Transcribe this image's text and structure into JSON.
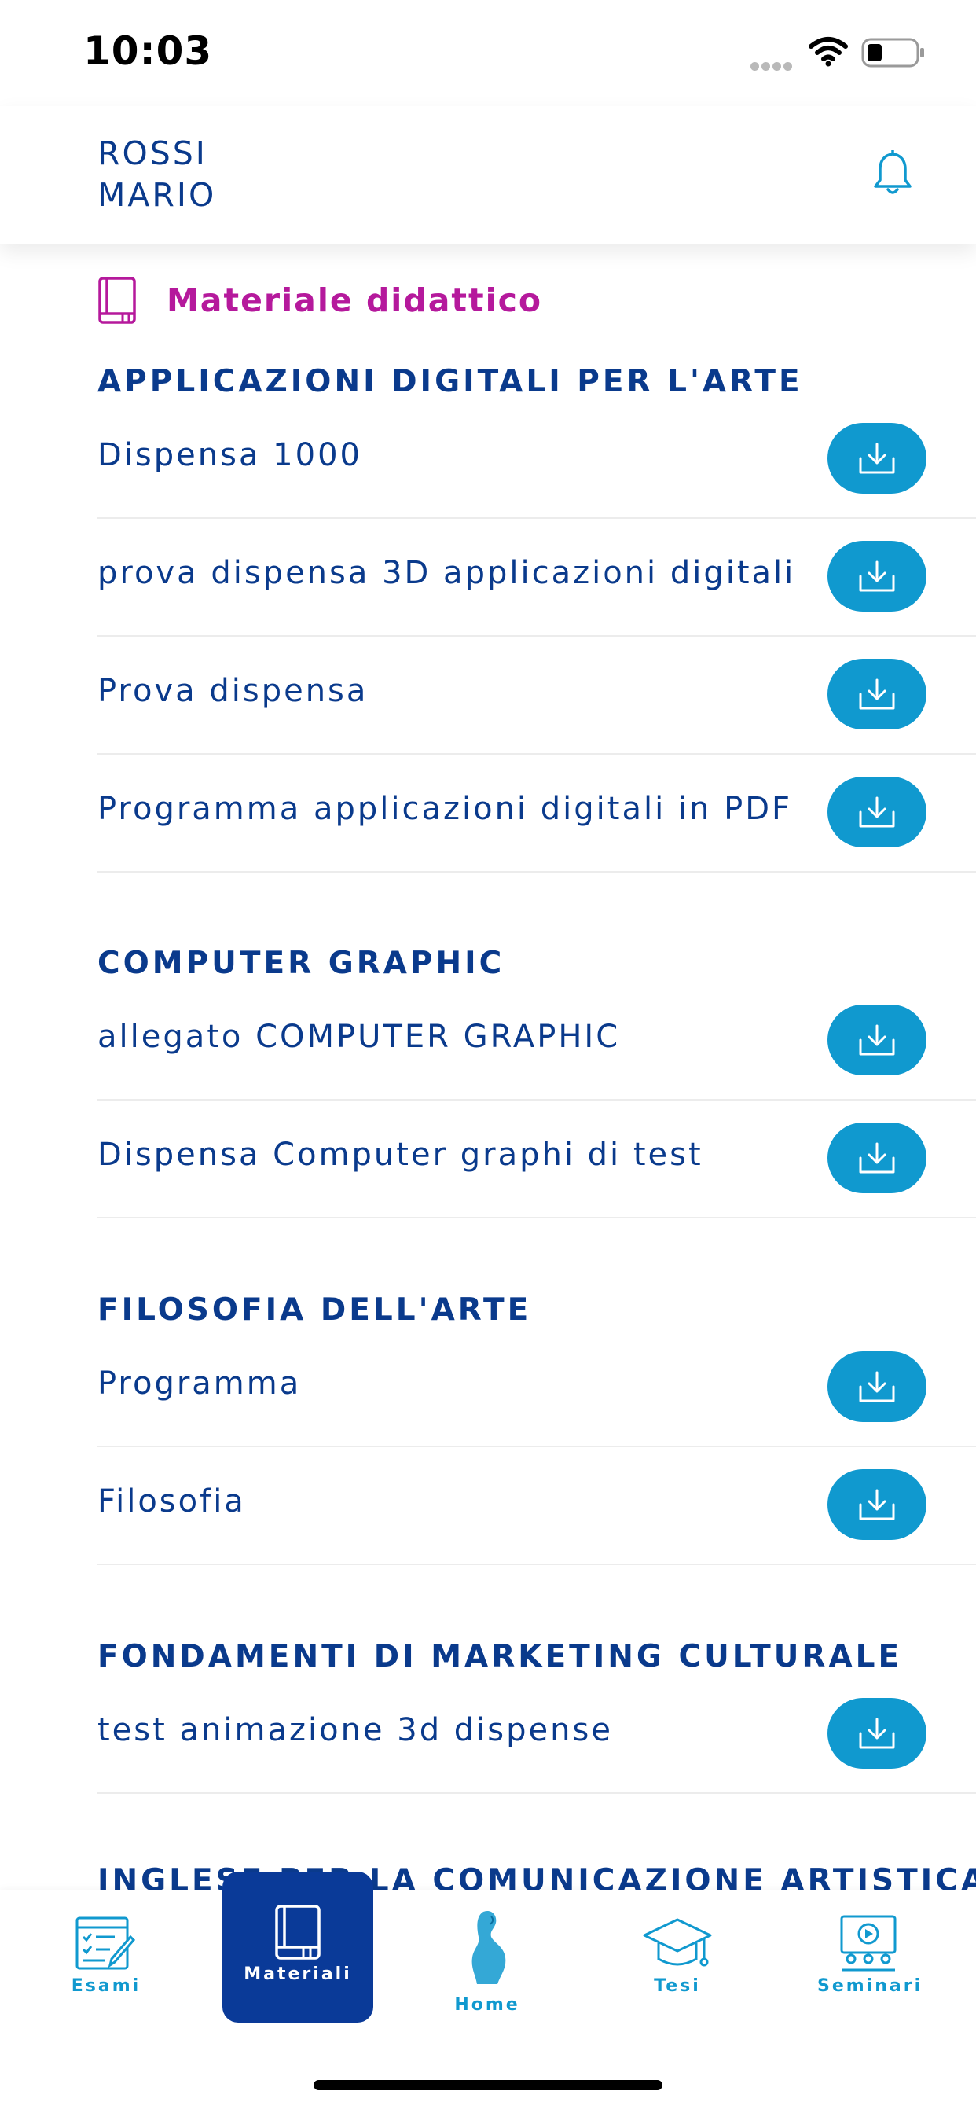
{
  "status_bar": {
    "time": "10:03"
  },
  "header": {
    "user_line1": "ROSSI",
    "user_line2": "MARIO",
    "bell_icon": "bell-icon"
  },
  "section": {
    "title": "Materiale didattico",
    "icon": "book-icon",
    "title_color": "#b5199c"
  },
  "groups": [
    {
      "title": "APPLICAZIONI DIGITALI PER L'ARTE",
      "items": [
        "Dispensa 1000",
        "prova dispensa 3D applicazioni digitali",
        "Prova dispensa",
        "Programma applicazioni digitali in PDF"
      ]
    },
    {
      "title": "COMPUTER GRAPHIC",
      "items": [
        "allegato COMPUTER GRAPHIC",
        "Dispensa Computer graphi di test"
      ]
    },
    {
      "title": "FILOSOFIA DELL'ARTE",
      "items": [
        "Programma",
        "Filosofia"
      ]
    },
    {
      "title": "FONDAMENTI DI MARKETING CULTURALE",
      "items": [
        "test animazione 3d dispense"
      ]
    },
    {
      "title": "INGLESE PER LA COMUNICAZIONE ARTISTICA",
      "items": []
    }
  ],
  "tabbar": {
    "tabs": [
      {
        "label": "Esami",
        "icon": "exam-icon"
      },
      {
        "label": "Materiali",
        "icon": "book-icon",
        "active": true
      },
      {
        "label": "Home",
        "icon": "statue-icon"
      },
      {
        "label": "Tesi",
        "icon": "graduation-cap-icon"
      },
      {
        "label": "Seminari",
        "icon": "seminar-icon"
      }
    ]
  },
  "colors": {
    "primary": "#0a3a8c",
    "accent": "#1099cf",
    "magenta": "#b5199c",
    "active_tab": "#0a3a98"
  }
}
